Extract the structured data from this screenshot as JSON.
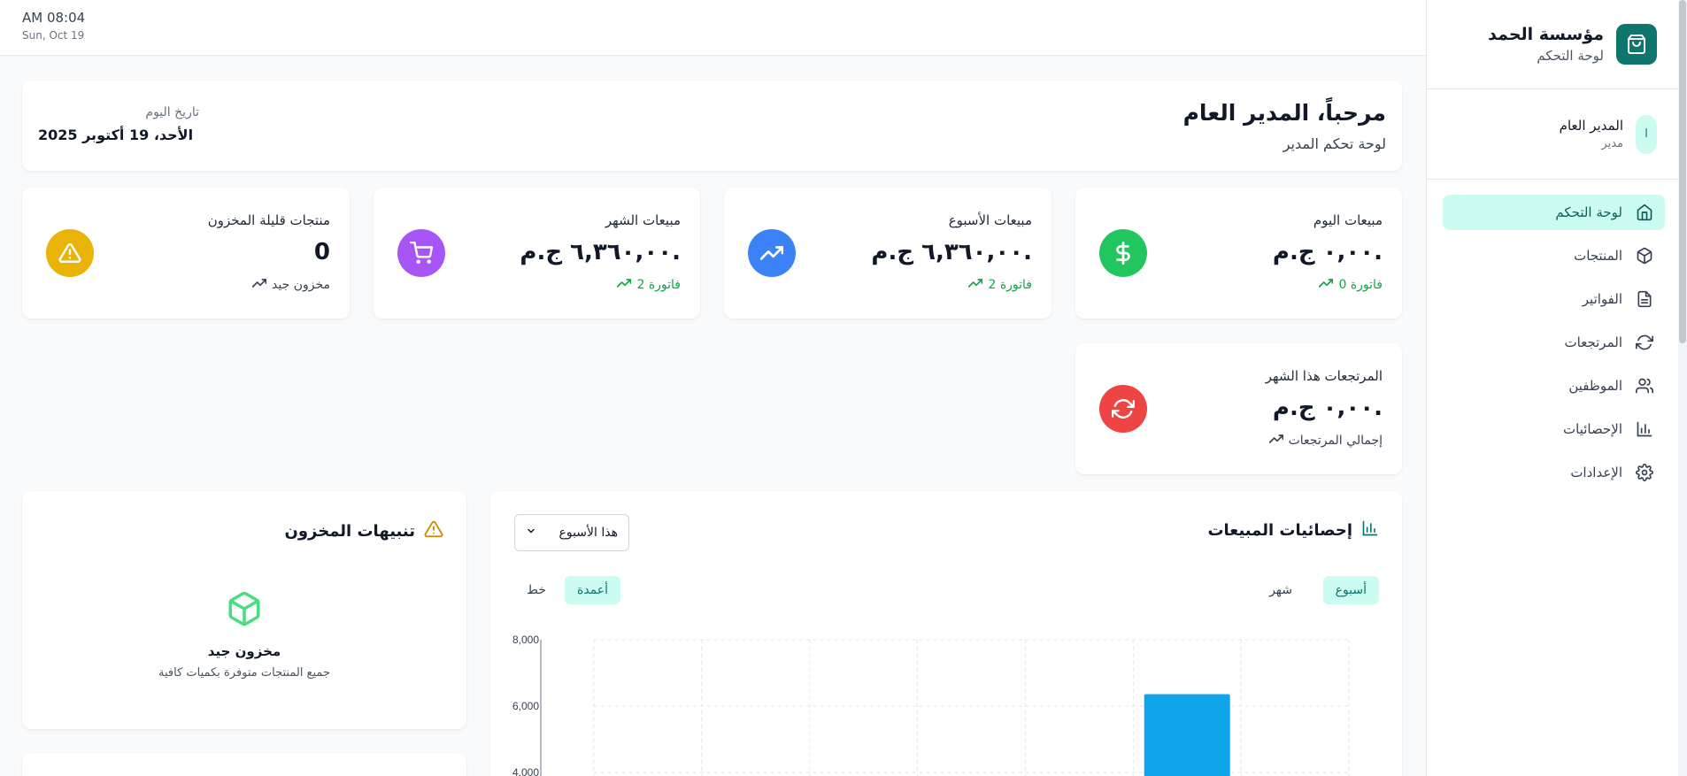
{
  "brand": {
    "name": "مؤسسة الحمد",
    "subtitle": "لوحة التحكم"
  },
  "user": {
    "name": "المدير العام",
    "role": "مدير",
    "initial": "ا"
  },
  "nav": [
    {
      "label": "لوحة التحكم",
      "icon": "home-icon",
      "active": true
    },
    {
      "label": "المنتجات",
      "icon": "box-icon"
    },
    {
      "label": "الفواتير",
      "icon": "file-icon"
    },
    {
      "label": "المرتجعات",
      "icon": "refresh-icon"
    },
    {
      "label": "الموظفين",
      "icon": "users-icon"
    },
    {
      "label": "الإحصائيات",
      "icon": "bar-chart-icon"
    },
    {
      "label": "الإعدادات",
      "icon": "gear-icon"
    }
  ],
  "topbar": {
    "time": "AM 08:04",
    "date": "Sun, Oct 19"
  },
  "welcome": {
    "title": "مرحباً، المدير العام",
    "subtitle": "لوحة تحكم المدير",
    "date_label": "تاريخ اليوم",
    "date_value": "الأحد، 19 أكتوبر 2025"
  },
  "stats": {
    "today": {
      "label": "مبيعات اليوم",
      "value": "٠,٠٠ ج.م.",
      "sub": "0 فاتورة"
    },
    "week": {
      "label": "مبيعات الأسبوع",
      "value": "٦,٣٦٠,٠٠ ج.م.",
      "sub": "2 فاتورة"
    },
    "month": {
      "label": "مبيعات الشهر",
      "value": "٦,٣٦٠,٠٠ ج.م.",
      "sub": "2 فاتورة"
    },
    "low_stock": {
      "label": "منتجات قليلة المخزون",
      "value": "0",
      "sub": "مخزون جيد"
    },
    "returns": {
      "label": "المرتجعات هذا الشهر",
      "value": "٠,٠٠ ج.م.",
      "sub": "إجمالي المرتجعات"
    }
  },
  "sales_stats": {
    "title": "إحصائيات المبيعات",
    "range": "هذا الأسبوع",
    "period_tabs": [
      "أسبوع",
      "شهر"
    ],
    "chart_tabs": [
      "أعمدة",
      "خط"
    ]
  },
  "stock_alerts": {
    "title": "تنبيهات المخزون",
    "empty_title": "مخزون جيد",
    "empty_sub": "جميع المنتجات متوفرة بكميات كافية"
  },
  "colors": {
    "accent": "#0f766e",
    "green": "#22c55e",
    "blue": "#3b82f6",
    "purple": "#a855f7",
    "yellow": "#eab308",
    "red": "#ef4444",
    "bar": "#0ea5e9"
  },
  "chart_data": {
    "type": "bar",
    "categories": [
      "",
      "",
      "",
      "",
      "",
      "",
      ""
    ],
    "values": [
      0,
      0,
      0,
      0,
      0,
      6360,
      0
    ],
    "ylim": [
      0,
      8000
    ],
    "yticks": [
      "4,000",
      "6,000",
      "8,000"
    ],
    "grid": true
  }
}
